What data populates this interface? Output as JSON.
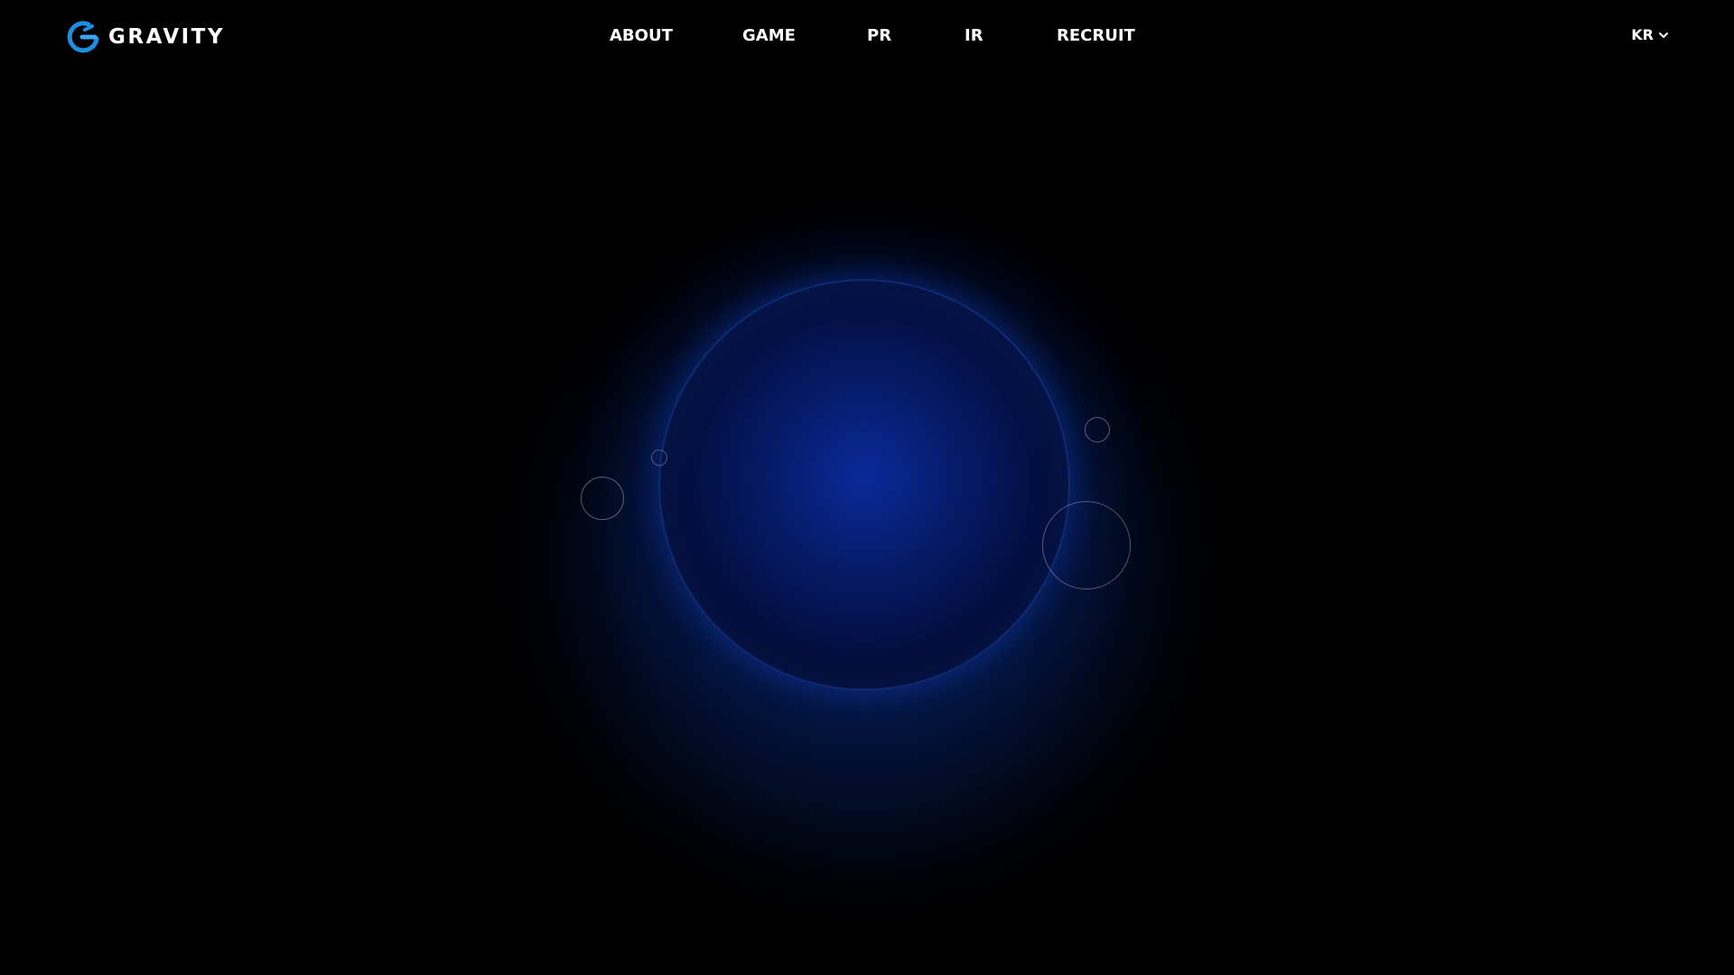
{
  "header": {
    "logo": {
      "text": "GRAVITY",
      "icon": "gravity-logo-icon",
      "color_primary": "#1e8fe0",
      "color_secondary": "#3aa7f0"
    },
    "nav": {
      "items": [
        {
          "label": "ABOUT"
        },
        {
          "label": "GAME"
        },
        {
          "label": "PR"
        },
        {
          "label": "IR"
        },
        {
          "label": "RECRUIT"
        }
      ]
    },
    "language": {
      "label": "KR",
      "icon": "chevron-down-icon"
    }
  },
  "hero": {
    "planet_color": "#0a2a9a",
    "glow_color": "#1446c8",
    "background": "#000000"
  }
}
